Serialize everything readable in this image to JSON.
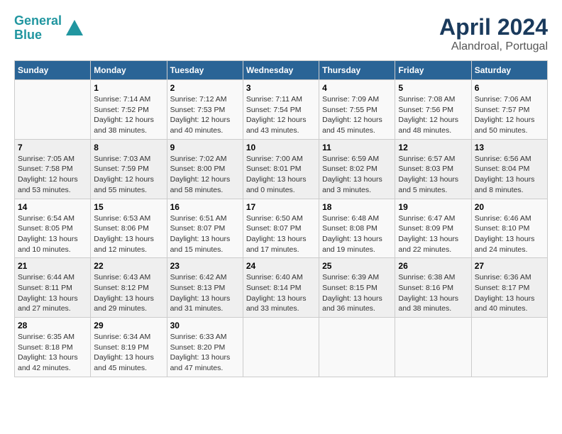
{
  "header": {
    "logo_line1": "General",
    "logo_line2": "Blue",
    "title": "April 2024",
    "subtitle": "Alandroal, Portugal"
  },
  "columns": [
    "Sunday",
    "Monday",
    "Tuesday",
    "Wednesday",
    "Thursday",
    "Friday",
    "Saturday"
  ],
  "weeks": [
    [
      {
        "day": "",
        "info": ""
      },
      {
        "day": "1",
        "info": "Sunrise: 7:14 AM\nSunset: 7:52 PM\nDaylight: 12 hours\nand 38 minutes."
      },
      {
        "day": "2",
        "info": "Sunrise: 7:12 AM\nSunset: 7:53 PM\nDaylight: 12 hours\nand 40 minutes."
      },
      {
        "day": "3",
        "info": "Sunrise: 7:11 AM\nSunset: 7:54 PM\nDaylight: 12 hours\nand 43 minutes."
      },
      {
        "day": "4",
        "info": "Sunrise: 7:09 AM\nSunset: 7:55 PM\nDaylight: 12 hours\nand 45 minutes."
      },
      {
        "day": "5",
        "info": "Sunrise: 7:08 AM\nSunset: 7:56 PM\nDaylight: 12 hours\nand 48 minutes."
      },
      {
        "day": "6",
        "info": "Sunrise: 7:06 AM\nSunset: 7:57 PM\nDaylight: 12 hours\nand 50 minutes."
      }
    ],
    [
      {
        "day": "7",
        "info": "Sunrise: 7:05 AM\nSunset: 7:58 PM\nDaylight: 12 hours\nand 53 minutes."
      },
      {
        "day": "8",
        "info": "Sunrise: 7:03 AM\nSunset: 7:59 PM\nDaylight: 12 hours\nand 55 minutes."
      },
      {
        "day": "9",
        "info": "Sunrise: 7:02 AM\nSunset: 8:00 PM\nDaylight: 12 hours\nand 58 minutes."
      },
      {
        "day": "10",
        "info": "Sunrise: 7:00 AM\nSunset: 8:01 PM\nDaylight: 13 hours\nand 0 minutes."
      },
      {
        "day": "11",
        "info": "Sunrise: 6:59 AM\nSunset: 8:02 PM\nDaylight: 13 hours\nand 3 minutes."
      },
      {
        "day": "12",
        "info": "Sunrise: 6:57 AM\nSunset: 8:03 PM\nDaylight: 13 hours\nand 5 minutes."
      },
      {
        "day": "13",
        "info": "Sunrise: 6:56 AM\nSunset: 8:04 PM\nDaylight: 13 hours\nand 8 minutes."
      }
    ],
    [
      {
        "day": "14",
        "info": "Sunrise: 6:54 AM\nSunset: 8:05 PM\nDaylight: 13 hours\nand 10 minutes."
      },
      {
        "day": "15",
        "info": "Sunrise: 6:53 AM\nSunset: 8:06 PM\nDaylight: 13 hours\nand 12 minutes."
      },
      {
        "day": "16",
        "info": "Sunrise: 6:51 AM\nSunset: 8:07 PM\nDaylight: 13 hours\nand 15 minutes."
      },
      {
        "day": "17",
        "info": "Sunrise: 6:50 AM\nSunset: 8:07 PM\nDaylight: 13 hours\nand 17 minutes."
      },
      {
        "day": "18",
        "info": "Sunrise: 6:48 AM\nSunset: 8:08 PM\nDaylight: 13 hours\nand 19 minutes."
      },
      {
        "day": "19",
        "info": "Sunrise: 6:47 AM\nSunset: 8:09 PM\nDaylight: 13 hours\nand 22 minutes."
      },
      {
        "day": "20",
        "info": "Sunrise: 6:46 AM\nSunset: 8:10 PM\nDaylight: 13 hours\nand 24 minutes."
      }
    ],
    [
      {
        "day": "21",
        "info": "Sunrise: 6:44 AM\nSunset: 8:11 PM\nDaylight: 13 hours\nand 27 minutes."
      },
      {
        "day": "22",
        "info": "Sunrise: 6:43 AM\nSunset: 8:12 PM\nDaylight: 13 hours\nand 29 minutes."
      },
      {
        "day": "23",
        "info": "Sunrise: 6:42 AM\nSunset: 8:13 PM\nDaylight: 13 hours\nand 31 minutes."
      },
      {
        "day": "24",
        "info": "Sunrise: 6:40 AM\nSunset: 8:14 PM\nDaylight: 13 hours\nand 33 minutes."
      },
      {
        "day": "25",
        "info": "Sunrise: 6:39 AM\nSunset: 8:15 PM\nDaylight: 13 hours\nand 36 minutes."
      },
      {
        "day": "26",
        "info": "Sunrise: 6:38 AM\nSunset: 8:16 PM\nDaylight: 13 hours\nand 38 minutes."
      },
      {
        "day": "27",
        "info": "Sunrise: 6:36 AM\nSunset: 8:17 PM\nDaylight: 13 hours\nand 40 minutes."
      }
    ],
    [
      {
        "day": "28",
        "info": "Sunrise: 6:35 AM\nSunset: 8:18 PM\nDaylight: 13 hours\nand 42 minutes."
      },
      {
        "day": "29",
        "info": "Sunrise: 6:34 AM\nSunset: 8:19 PM\nDaylight: 13 hours\nand 45 minutes."
      },
      {
        "day": "30",
        "info": "Sunrise: 6:33 AM\nSunset: 8:20 PM\nDaylight: 13 hours\nand 47 minutes."
      },
      {
        "day": "",
        "info": ""
      },
      {
        "day": "",
        "info": ""
      },
      {
        "day": "",
        "info": ""
      },
      {
        "day": "",
        "info": ""
      }
    ]
  ]
}
